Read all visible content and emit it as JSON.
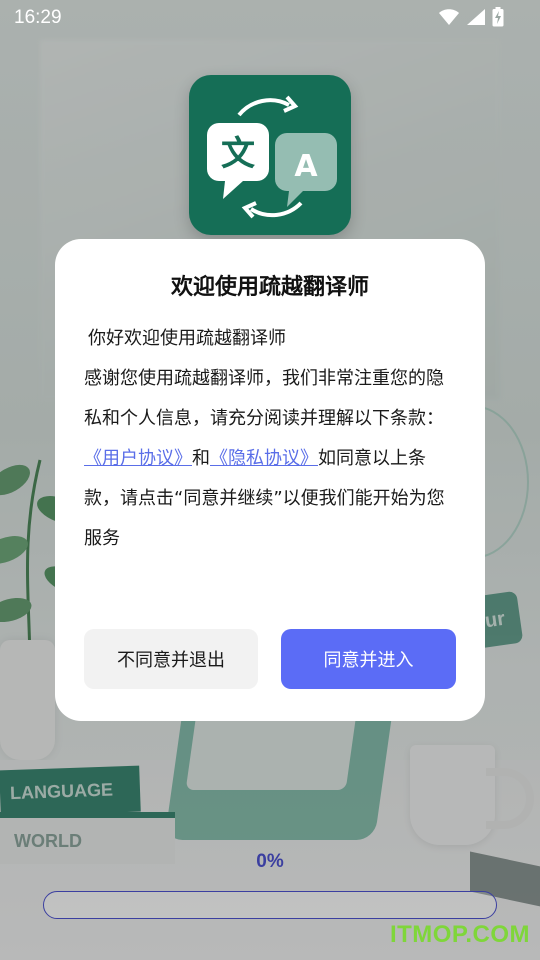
{
  "status_bar": {
    "time": "16:29"
  },
  "background": {
    "book_top_label": "LANGUAGE",
    "book_bottom_label": "WORLD",
    "tag_label": "ur"
  },
  "app_icon": {
    "glyph_left": "文",
    "glyph_right": "A"
  },
  "dialog": {
    "title": "欢迎使用疏越翻译师",
    "greeting": "你好欢迎使用疏越翻译师",
    "intro": "感谢您使用疏越翻译师，我们非常注重您的隐私和个人信息，请充分阅读并理解以下条款：",
    "user_agreement_link": "《用户协议》",
    "and": "和",
    "privacy_link": "《隐私协议》",
    "consent_text": "如同意以上条款，请点击“同意并继续”以便我们能开始为您服务",
    "decline_button": "不同意并退出",
    "accept_button": "同意并进入"
  },
  "progress": {
    "label": "0%",
    "value": 0
  },
  "watermark": "ITMOP.COM"
}
